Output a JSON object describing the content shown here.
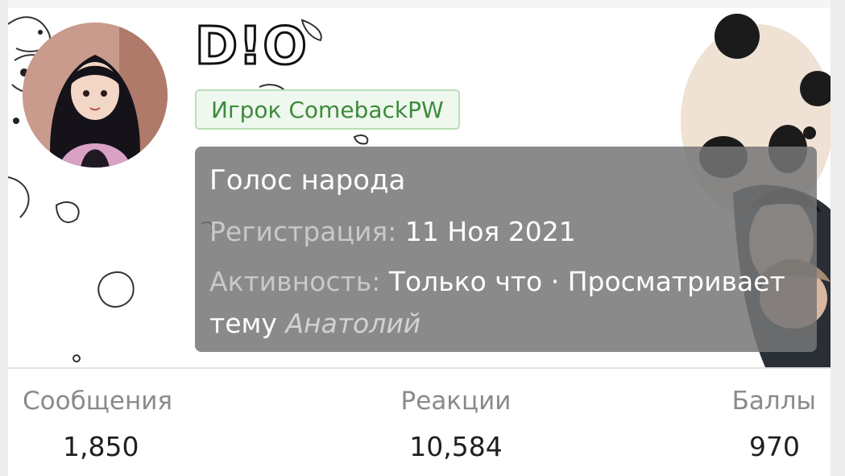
{
  "profile": {
    "username": "D!O",
    "badge": "Игрок ComebackPW",
    "user_title": "Голос народа",
    "registration_label": "Регистрация:",
    "registration_value": "11 Ноя 2021",
    "activity_label": "Активность:",
    "activity_value": "Только что · Просматривает",
    "activity_topic_prefix": "тему",
    "activity_topic_name": "Анатолий"
  },
  "stats": [
    {
      "label": "Сообщения",
      "value": "1,850"
    },
    {
      "label": "Реакции",
      "value": "10,584"
    },
    {
      "label": "Баллы",
      "value": "970"
    }
  ],
  "colors": {
    "badge_text": "#3e8b3b",
    "badge_border": "#b9dfb6",
    "info_panel": "#767676",
    "label_muted": "#8a8a8a"
  }
}
